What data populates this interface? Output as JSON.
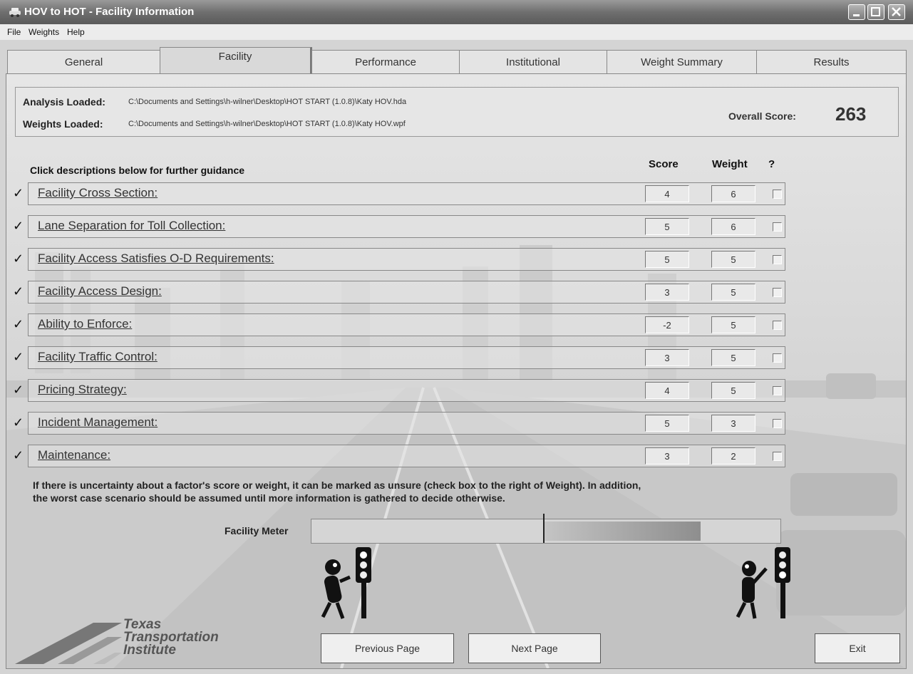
{
  "window": {
    "title": "HOV to HOT - Facility Information"
  },
  "menu": [
    "File",
    "Weights",
    "Help"
  ],
  "tabs": [
    "General",
    "Facility",
    "Performance",
    "Institutional",
    "Weight Summary",
    "Results"
  ],
  "active_tab": "Facility",
  "info": {
    "analysis_label": "Analysis Loaded:",
    "analysis_path": "C:\\Documents and Settings\\h-wilner\\Desktop\\HOT START (1.0.8)\\Katy HOV.hda",
    "weights_label": "Weights Loaded:",
    "weights_path": "C:\\Documents and Settings\\h-wilner\\Desktop\\HOT START (1.0.8)\\Katy HOV.wpf",
    "overall_label": "Overall Score:",
    "overall_value": "263"
  },
  "table": {
    "guidance": "Click descriptions below for further guidance",
    "score_header": "Score",
    "weight_header": "Weight",
    "unsure_header": "?",
    "rows": [
      {
        "label": "Facility Cross Section:",
        "score": "4",
        "weight": "6"
      },
      {
        "label": "Lane Separation for Toll Collection:",
        "score": "5",
        "weight": "6"
      },
      {
        "label": "Facility Access Satisfies O-D Requirements:",
        "score": "5",
        "weight": "5"
      },
      {
        "label": "Facility Access Design:",
        "score": "3",
        "weight": "5"
      },
      {
        "label": "Ability to Enforce:",
        "score": "-2",
        "weight": "5"
      },
      {
        "label": "Facility Traffic Control:",
        "score": "3",
        "weight": "5"
      },
      {
        "label": "Pricing Strategy:",
        "score": "4",
        "weight": "5"
      },
      {
        "label": "Incident Management:",
        "score": "5",
        "weight": "3"
      },
      {
        "label": "Maintenance:",
        "score": "3",
        "weight": "2"
      }
    ]
  },
  "note_line1": "If there is uncertainty about a factor's score or weight, it can be marked as unsure (check box to the right of Weight).  In addition,",
  "note_line2": "the worst case scenario should be assumed until more information is gathered to decide otherwise.",
  "meter": {
    "label": "Facility Meter",
    "fill_start": 0.495,
    "fill_end": 0.83
  },
  "logo": {
    "line1": "Texas",
    "line2": "Transportation",
    "line3": "Institute"
  },
  "buttons": {
    "prev": "Previous Page",
    "next": "Next Page",
    "exit": "Exit"
  },
  "colors": {
    "titlebar": "#6f6f6f",
    "panel": "#e6e6e6",
    "meter_fill": "#8e8e8e"
  }
}
